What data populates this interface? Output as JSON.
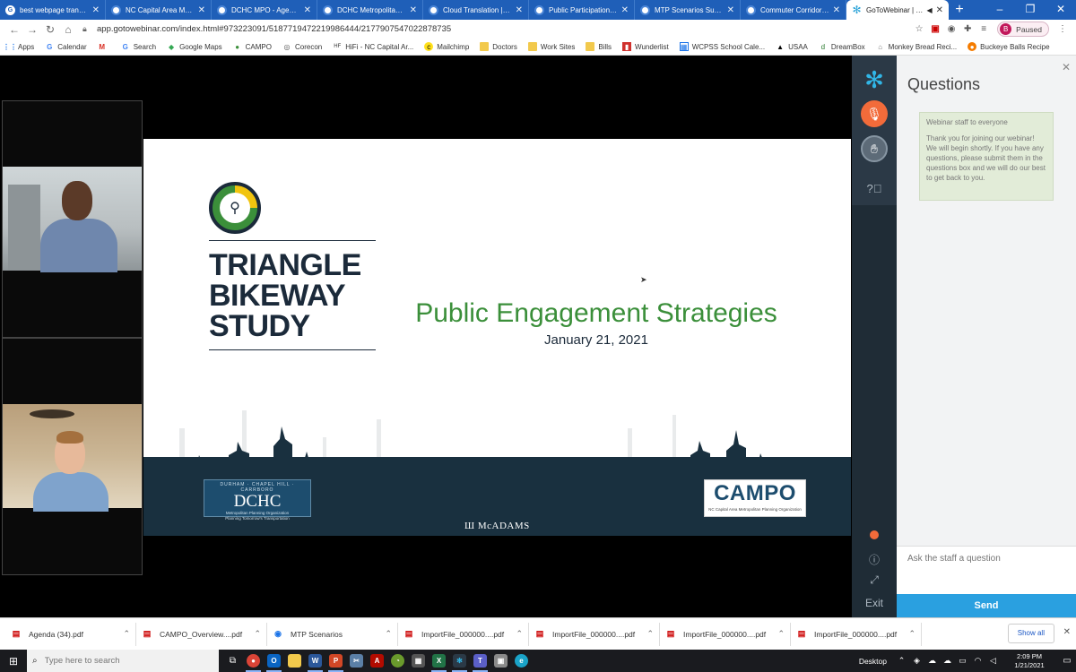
{
  "browser": {
    "tabs": [
      {
        "label": "best webpage translati",
        "icon": "google-icon"
      },
      {
        "label": "NC Capital Area Metro",
        "icon": "campo-icon"
      },
      {
        "label": "DCHC MPO - Agenda",
        "icon": "agenda-icon"
      },
      {
        "label": "DCHC Metropolitan Pla",
        "icon": "campo-icon"
      },
      {
        "label": "Cloud Translation | Go",
        "icon": "cloud-icon"
      },
      {
        "label": "Public Participation Pla",
        "icon": "pdf-icon"
      },
      {
        "label": "MTP Scenarios Survey",
        "icon": "survey-icon"
      },
      {
        "label": "Commuter Corridors St",
        "icon": "pdf-icon"
      },
      {
        "label": "GoToWebinar | Go",
        "icon": "gotowebinar-icon",
        "active": true
      }
    ],
    "url": "app.gotowebinar.com/index.html#973223091/5187719472219986444/2177907547022878735",
    "profile": {
      "initial": "B",
      "status": "Paused"
    },
    "bookmarks": [
      {
        "label": "Apps",
        "icon": "apps-grid-icon"
      },
      {
        "label": "Calendar",
        "icon": "google-icon"
      },
      {
        "label": "",
        "icon": "gmail-icon"
      },
      {
        "label": "Search",
        "icon": "google-icon"
      },
      {
        "label": "Google Maps",
        "icon": "maps-icon"
      },
      {
        "label": "CAMPO",
        "icon": "campo-icon"
      },
      {
        "label": "Corecon",
        "icon": "corecon-icon"
      },
      {
        "label": "HiFi - NC Capital Ar...",
        "icon": "hifi-icon"
      },
      {
        "label": "Mailchimp",
        "icon": "mailchimp-icon"
      },
      {
        "label": "Doctors",
        "icon": "folder-icon"
      },
      {
        "label": "Work Sites",
        "icon": "folder-icon"
      },
      {
        "label": "Bills",
        "icon": "folder-icon"
      },
      {
        "label": "Wunderlist",
        "icon": "wunderlist-icon"
      },
      {
        "label": "WCPSS School Cale...",
        "icon": "calendar-icon"
      },
      {
        "label": "USAA",
        "icon": "usaa-icon"
      },
      {
        "label": "DreamBox",
        "icon": "dreambox-icon"
      },
      {
        "label": "Monkey Bread Reci...",
        "icon": "recipe-icon"
      },
      {
        "label": "Buckeye Balls Recipe",
        "icon": "recipe-icon"
      }
    ]
  },
  "slide": {
    "study_lines": [
      "TRIANGLE",
      "BIKEWAY",
      "STUDY"
    ],
    "title": "Public Engagement Strategies",
    "date": "January 21, 2021",
    "dchc": {
      "top": "DURHAM · CHAPEL HILL · CARRBORO",
      "big": "DCHC",
      "sub1": "Metropolitan Planning Organization",
      "sub2": "Planning Tomorrow's Transportation"
    },
    "mcadams": "McADAMS",
    "campo": {
      "big": "CAMPO",
      "sub": "NC Capital Area Metropolitan Planning Organization"
    },
    "colors": {
      "navy": "#1b2a3a",
      "green": "#3b8f3a",
      "ground": "#19303f"
    }
  },
  "webinar": {
    "panel_title": "Questions",
    "message": {
      "from": "Webinar staff to everyone",
      "text": "Thank you for joining our webinar! We will begin shortly. If you have any questions, please submit them in the questions box and we will do our best to get back to you."
    },
    "input_placeholder": "Ask the staff a question",
    "send_label": "Send",
    "exit_label": "Exit",
    "accent": "#2aa0e0",
    "mic_color": "#f26b3a"
  },
  "downloads": {
    "items": [
      {
        "name": "Agenda (34).pdf",
        "icon": "pdf-icon"
      },
      {
        "name": "CAMPO_Overview....pdf",
        "icon": "pdf-icon"
      },
      {
        "name": "MTP Scenarios",
        "icon": "chrome-icon"
      },
      {
        "name": "ImportFile_000000....pdf",
        "icon": "pdf-icon"
      },
      {
        "name": "ImportFile_000000....pdf",
        "icon": "pdf-icon"
      },
      {
        "name": "ImportFile_000000....pdf",
        "icon": "pdf-icon"
      },
      {
        "name": "ImportFile_000000....pdf",
        "icon": "pdf-icon"
      }
    ],
    "show_all": "Show all"
  },
  "taskbar": {
    "search_placeholder": "Type here to search",
    "desktop_label": "Desktop",
    "time": "2:09 PM",
    "date": "1/21/2021"
  }
}
